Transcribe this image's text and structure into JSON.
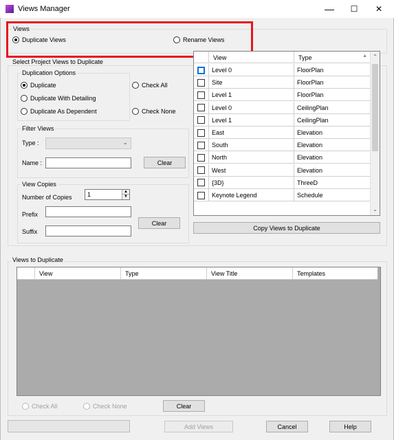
{
  "window": {
    "title": "Views Manager",
    "minimize": "—",
    "maximize": "☐",
    "close": "✕"
  },
  "views_group": {
    "label": "Views",
    "options": [
      {
        "label": "Duplicate Views",
        "checked": true
      },
      {
        "label": "Rename Views",
        "checked": false
      }
    ]
  },
  "select_group": {
    "label": "Select Project Views to Duplicate"
  },
  "duplication_options": {
    "label": "Duplication Options",
    "options": [
      {
        "label": "Duplicate",
        "checked": true
      },
      {
        "label": "Duplicate With Detailing",
        "checked": false
      },
      {
        "label": "Duplicate As Dependent",
        "checked": false
      }
    ],
    "check_all": "Check All",
    "check_none": "Check None"
  },
  "filter_views": {
    "label": "Filter Views",
    "type_label": "Type :",
    "type_value": "",
    "name_label": "Name :",
    "name_value": "",
    "clear": "Clear"
  },
  "view_copies": {
    "label": "View Copies",
    "number_label": "Number of Copies",
    "number_value": "1",
    "prefix_label": "Prefix",
    "prefix_value": "",
    "suffix_label": "Suffix",
    "suffix_value": "",
    "clear": "Clear"
  },
  "views_table": {
    "columns": [
      "View",
      "Type"
    ],
    "rows": [
      {
        "view": "Level 0",
        "type": "FloorPlan"
      },
      {
        "view": "Site",
        "type": "FloorPlan"
      },
      {
        "view": "Level 1",
        "type": "FloorPlan"
      },
      {
        "view": "Level 0",
        "type": "CeilingPlan"
      },
      {
        "view": "Level 1",
        "type": "CeilingPlan"
      },
      {
        "view": "East",
        "type": "Elevation"
      },
      {
        "view": "South",
        "type": "Elevation"
      },
      {
        "view": "North",
        "type": "Elevation"
      },
      {
        "view": "West",
        "type": "Elevation"
      },
      {
        "view": "{3D}",
        "type": "ThreeD"
      },
      {
        "view": "Keynote Legend",
        "type": "Schedule"
      }
    ],
    "copy_button": "Copy Views to Duplicate"
  },
  "views_to_duplicate": {
    "label": "Views to Duplicate",
    "columns": [
      "View",
      "Type",
      "View Title",
      "Templates"
    ],
    "check_all": "Check All",
    "check_none": "Check None",
    "clear": "Clear"
  },
  "footer": {
    "add_views": "Add Views",
    "cancel": "Cancel",
    "help": "Help"
  },
  "colors": {
    "highlight_border": "#e8141c",
    "grid_empty": "#ababab",
    "accent": "#0a6fd8"
  }
}
